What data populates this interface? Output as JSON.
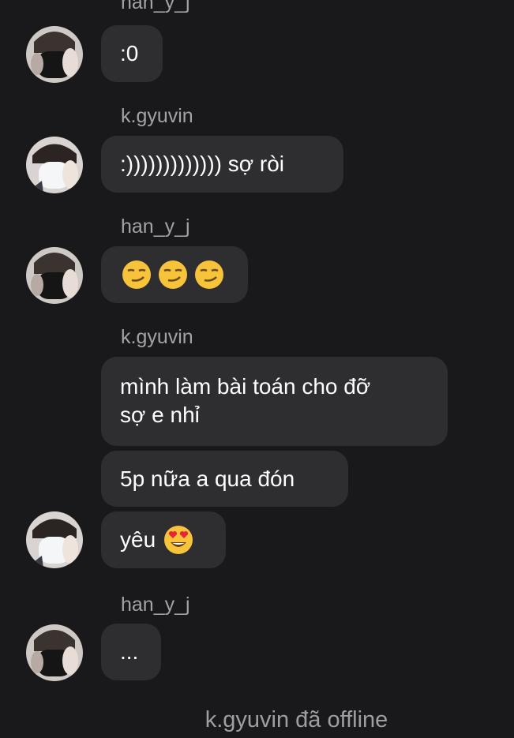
{
  "messages": [
    {
      "sender": "han_y_j",
      "text": ":0"
    },
    {
      "sender": "k.gyuvin",
      "text": ":))))))))))))) sợ ròi"
    },
    {
      "sender": "han_y_j",
      "text": "",
      "emoji": [
        "smirking-face",
        "smirking-face",
        "smirking-face"
      ]
    },
    {
      "sender": "k.gyuvin",
      "text_line1": "mình làm bài toán cho đỡ",
      "text_line2": "sợ e nhỉ"
    },
    {
      "sender": "k.gyuvin",
      "text": "5p nữa a qua đón"
    },
    {
      "sender": "k.gyuvin",
      "text": "yêu",
      "emoji": [
        "smiling-face-with-heart-eyes"
      ]
    },
    {
      "sender": "han_y_j",
      "text": "..."
    }
  ],
  "status_note": "k.gyuvin đã offline",
  "colors": {
    "background": "#19191b",
    "bubble": "#2e2e31",
    "sender_name": "#a2a2a8"
  }
}
